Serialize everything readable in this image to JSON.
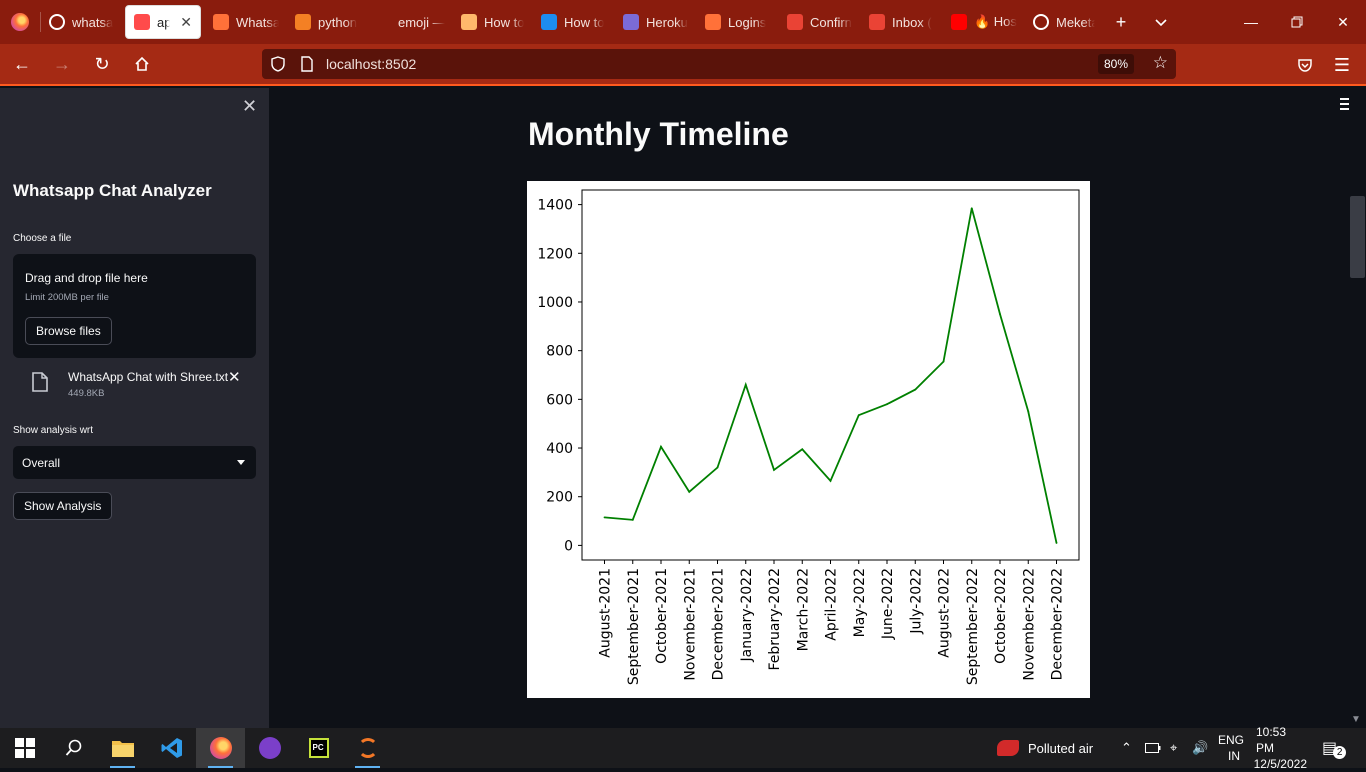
{
  "browser": {
    "tabs": [
      {
        "label": "whatsa",
        "icon": "github-icon",
        "active": false
      },
      {
        "label": "app",
        "icon": "streamlit-icon",
        "active": true
      },
      {
        "label": "Whatsa",
        "icon": "book-icon",
        "active": false
      },
      {
        "label": "python",
        "icon": "stackoverflow-icon",
        "active": false
      },
      {
        "label": "emoji — en",
        "icon": "blank-icon",
        "active": false
      },
      {
        "label": "How to",
        "icon": "tool-icon",
        "active": false
      },
      {
        "label": "How to",
        "icon": "k-icon",
        "active": false
      },
      {
        "label": "Heroku",
        "icon": "heroku-icon",
        "active": false
      },
      {
        "label": "Logins",
        "icon": "firefox-icon",
        "active": false
      },
      {
        "label": "Confirn",
        "icon": "gmail-icon",
        "active": false
      },
      {
        "label": "Inbox (",
        "icon": "gmail-icon",
        "active": false
      },
      {
        "label": "🔥 Host",
        "icon": "youtube-icon",
        "active": false
      },
      {
        "label": "Meketa",
        "icon": "github-icon",
        "active": false
      }
    ],
    "url": "localhost:8502",
    "zoom": "80%"
  },
  "sidebar": {
    "title": "Whatsapp Chat Analyzer",
    "file_label": "Choose a file",
    "dropzone_text": "Drag and drop file here",
    "dropzone_limit": "Limit 200MB per file",
    "browse_label": "Browse files",
    "uploaded_file": {
      "name": "WhatsApp Chat with Shree.txt",
      "size": "449.8KB"
    },
    "select_label": "Show analysis wrt",
    "select_value": "Overall",
    "analysis_button": "Show Analysis"
  },
  "main": {
    "heading": "Monthly Timeline"
  },
  "chart_data": {
    "type": "line",
    "title": "",
    "xlabel": "",
    "ylabel": "",
    "categories": [
      "August-2021",
      "September-2021",
      "October-2021",
      "November-2021",
      "December-2021",
      "January-2022",
      "February-2022",
      "March-2022",
      "April-2022",
      "May-2022",
      "June-2022",
      "July-2022",
      "August-2022",
      "September-2022",
      "October-2022",
      "November-2022",
      "December-2022"
    ],
    "series": [
      {
        "values": [
          115,
          105,
          405,
          220,
          320,
          660,
          310,
          395,
          265,
          535,
          580,
          640,
          755,
          1385,
          950,
          550,
          10
        ],
        "color": "#008000"
      }
    ],
    "ylim": [
      -60,
      1460
    ],
    "yticks": [
      0,
      200,
      400,
      600,
      800,
      1000,
      1200,
      1400
    ],
    "grid": false
  },
  "taskbar": {
    "weather": "Polluted air",
    "lang_line1": "ENG",
    "lang_line2": "IN",
    "time": "10:53 PM",
    "date": "12/5/2022",
    "notifications": "2"
  },
  "colors": {
    "tab_strip": "#8a1c0d",
    "nav_bar": "#a52a14",
    "sidebar_bg": "#262730",
    "app_bg": "#0e1117",
    "line": "#008000"
  }
}
